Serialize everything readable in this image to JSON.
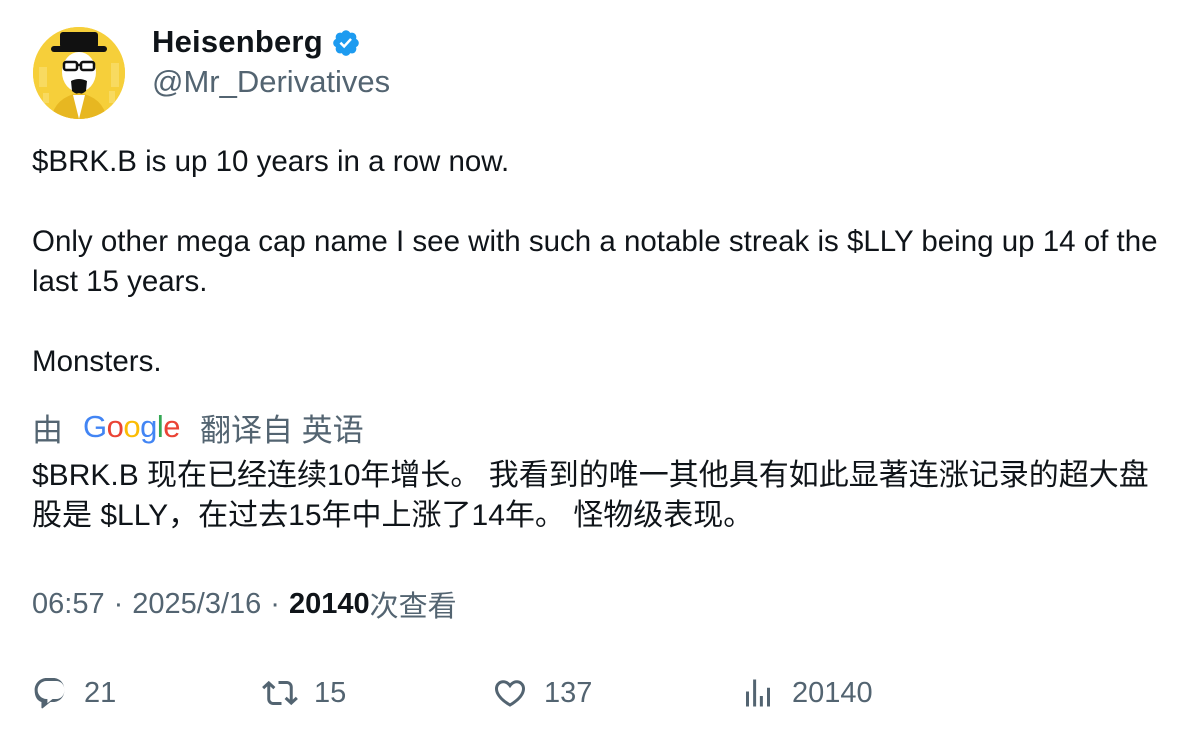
{
  "author": {
    "display_name": "Heisenberg",
    "handle": "@Mr_Derivatives",
    "verified": true,
    "verified_color": "#1d9bf0",
    "avatar_icon": "heisenberg-avatar-icon",
    "avatar_bg": "#f6cf3a"
  },
  "tweet": {
    "paragraphs": [
      "$BRK.B is up 10 years in a row now.",
      "Only other mega cap name I see with such a notable streak is $LLY being up 14 of the last 15 years.",
      "Monsters."
    ]
  },
  "translation": {
    "prefix": "由",
    "provider": "Google",
    "note": "翻译自 英语",
    "text": "$BRK.B 现在已经连续10年增长。 我看到的唯一其他具有如此显著连涨记录的超大盘股是 $LLY，在过去15年中上涨了14年。 怪物级表现。"
  },
  "meta": {
    "time": "06:57",
    "separator": "·",
    "date": "2025/3/16",
    "views_count": "20140",
    "views_suffix": "次查看"
  },
  "actions": {
    "reply": {
      "icon": "reply-icon",
      "count": "21"
    },
    "retweet": {
      "icon": "retweet-icon",
      "count": "15"
    },
    "like": {
      "icon": "heart-icon",
      "count": "137"
    },
    "views": {
      "icon": "analytics-icon",
      "count": "20140"
    }
  },
  "colors": {
    "text_primary": "#0f1419",
    "text_secondary": "#536471",
    "google_blue": "#4285f4",
    "google_red": "#ea4335",
    "google_yellow": "#fbbc05",
    "google_green": "#34a853"
  }
}
